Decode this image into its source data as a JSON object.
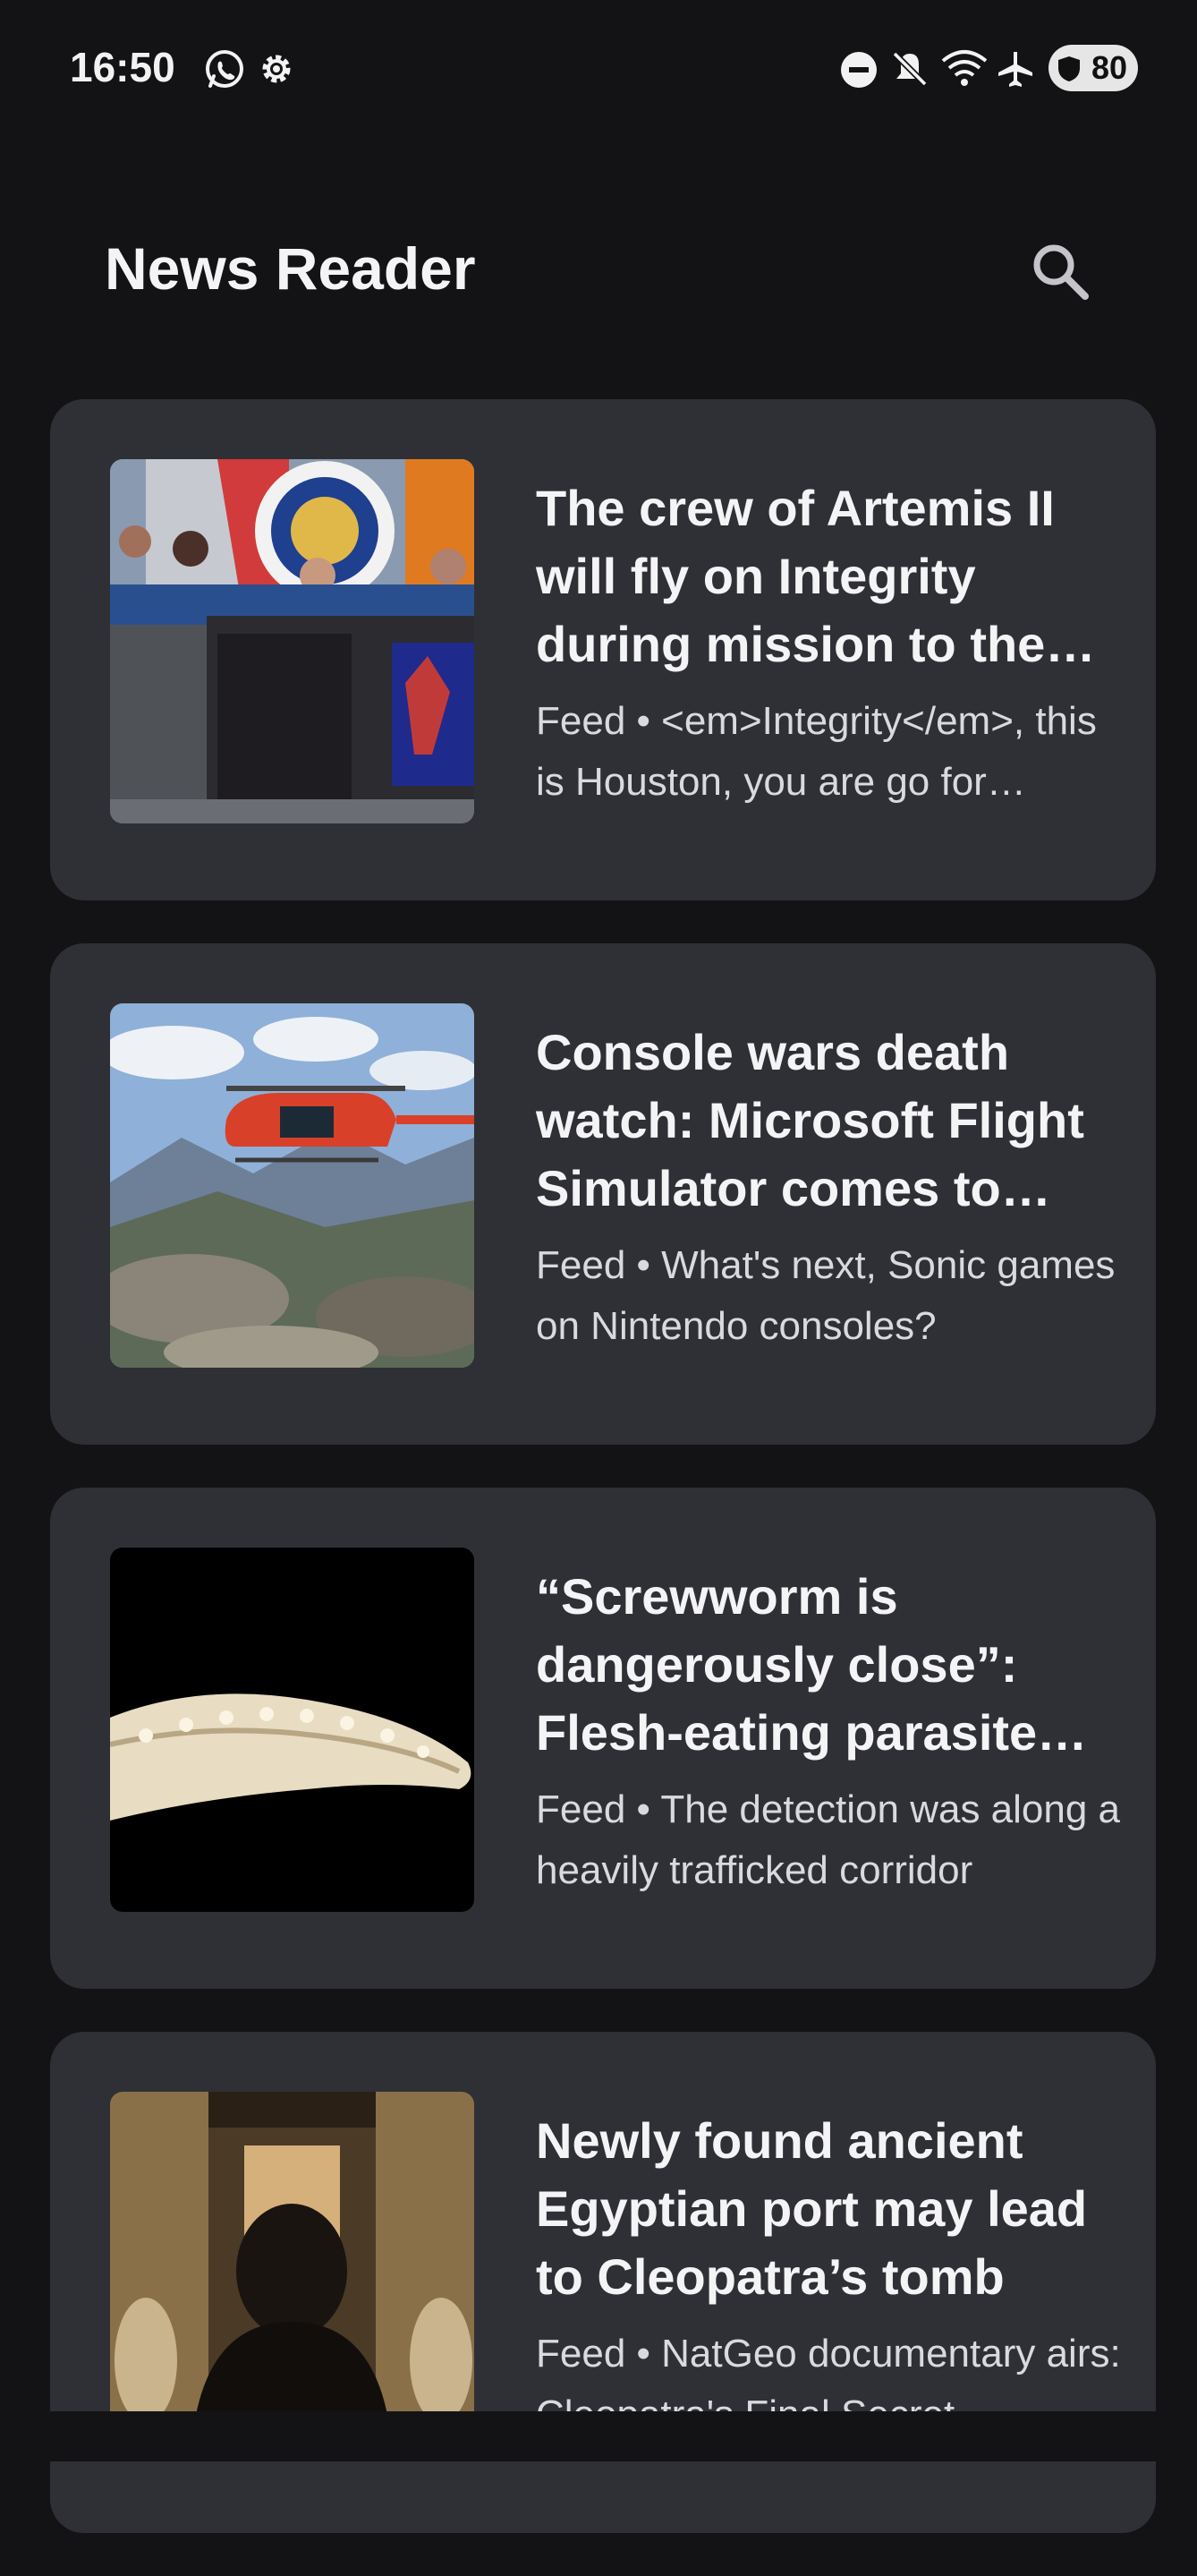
{
  "status_bar": {
    "time": "16:50",
    "battery": "80",
    "icons": [
      "whatsapp-icon",
      "settings-gear-icon",
      "do-not-disturb-icon",
      "mute-icon",
      "wifi-6-icon",
      "airplane-mode-icon",
      "battery-saver-icon"
    ]
  },
  "app_bar": {
    "title": "News Reader",
    "search_icon": "search-icon"
  },
  "articles": [
    {
      "title": "The crew of Artemis II will fly on Integrity during mission to the Moon",
      "meta": "Feed • <em>Integrity</em>, this is Houston, you are go for translunar injection"
    },
    {
      "title": "Console wars death watch: Microsoft Flight Simulator comes to PlayStation",
      "meta": "Feed • What's next, Sonic games on Nintendo consoles?"
    },
    {
      "title": "“Screwworm is dangerously close”: Flesh-eating parasite found in the US",
      "meta": "Feed • The detection was along a heavily trafficked corridor"
    },
    {
      "title": "Newly found ancient Egyptian port may lead to Cleopatra’s tomb",
      "meta": "Feed • NatGeo documentary airs: Cleopatra's Final Secret"
    }
  ],
  "colors": {
    "background": "#131316",
    "card": "#2f3035",
    "text": "#f4f4f6"
  }
}
